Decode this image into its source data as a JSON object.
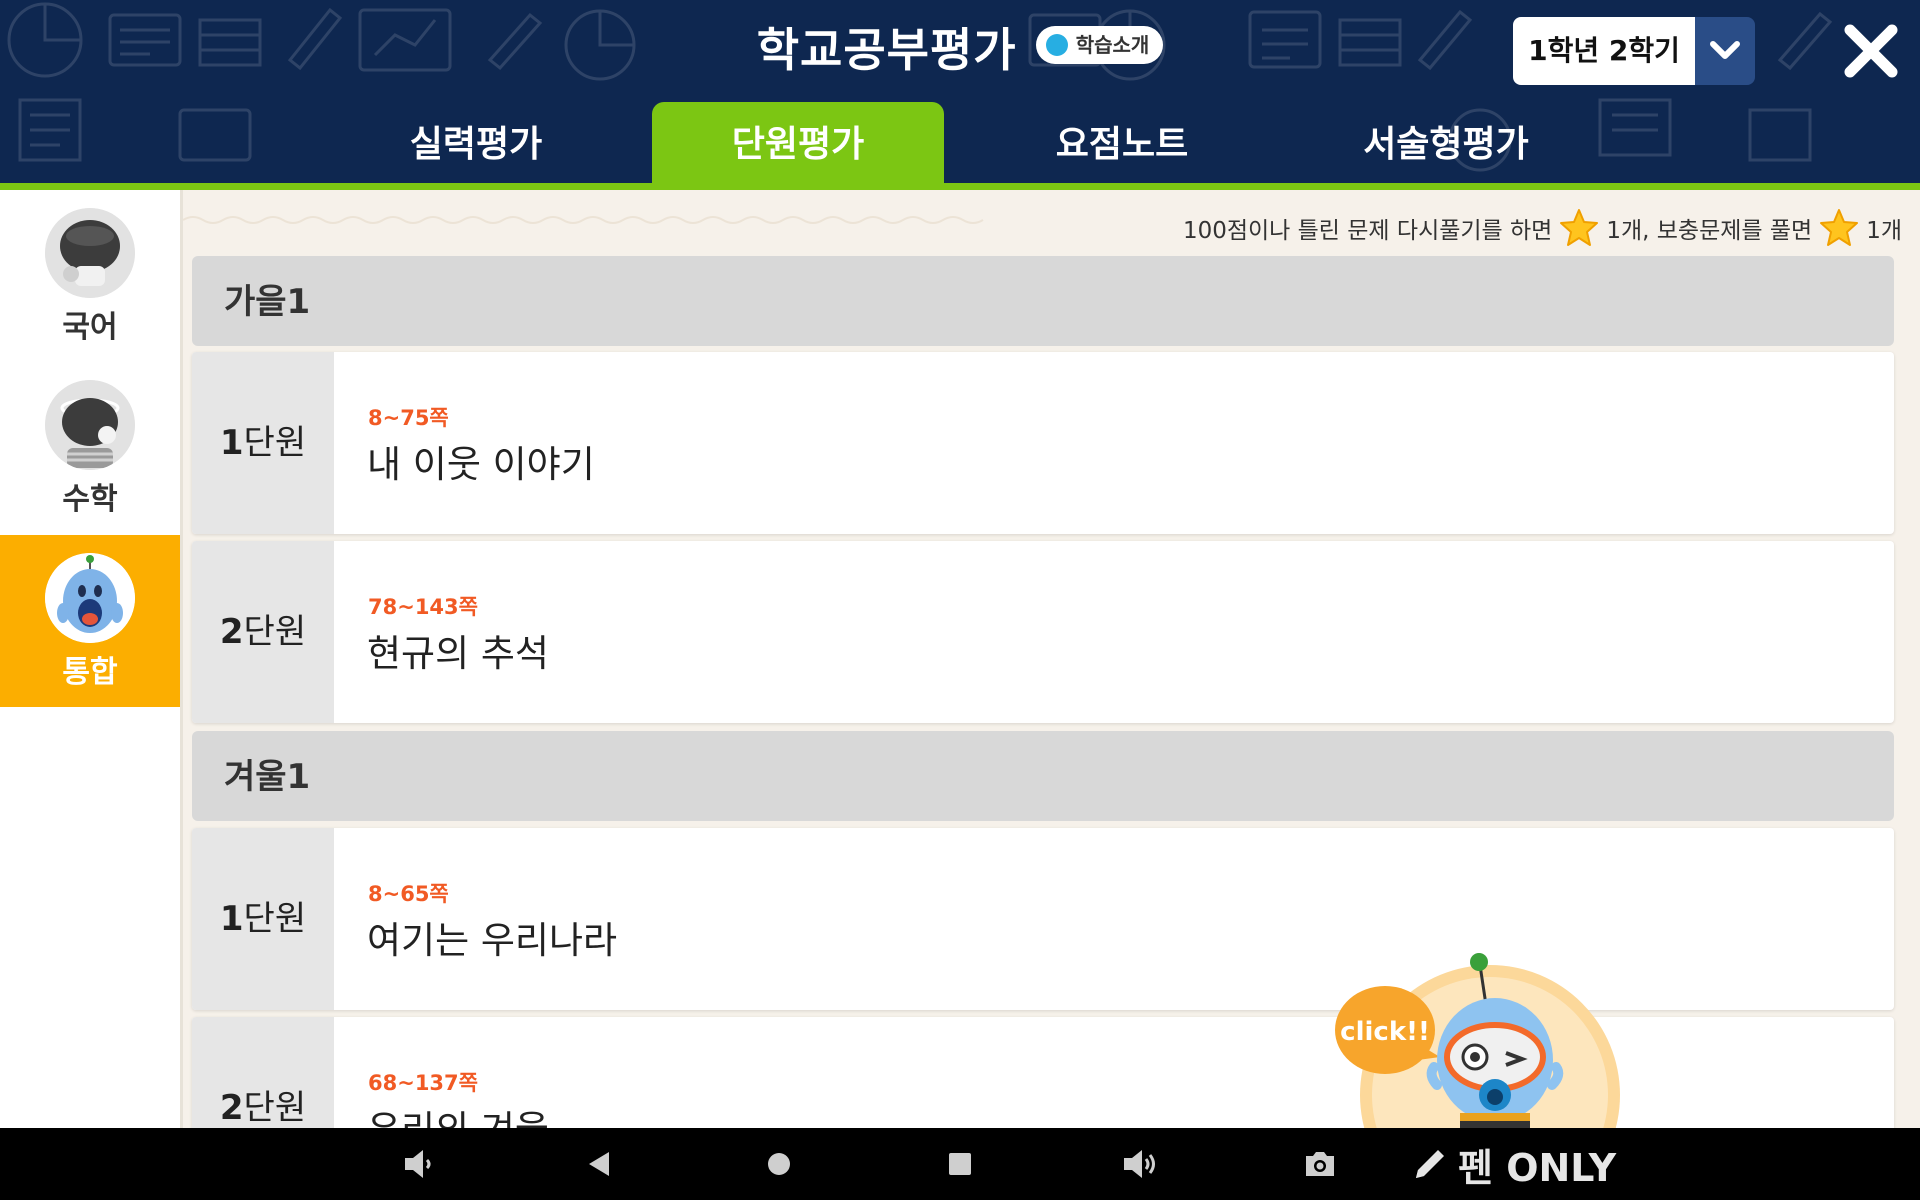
{
  "header": {
    "title": "학교공부평가",
    "intro_button": "학습소개",
    "grade_select": "1학년 2학기",
    "tabs": [
      {
        "label": "실력평가",
        "active": false
      },
      {
        "label": "단원평가",
        "active": true
      },
      {
        "label": "요점노트",
        "active": false
      },
      {
        "label": "서술형평가",
        "active": false
      }
    ]
  },
  "sidebar": {
    "items": [
      {
        "label": "국어",
        "active": false
      },
      {
        "label": "수학",
        "active": false
      },
      {
        "label": "통합",
        "active": true
      }
    ]
  },
  "notice": {
    "part1": "100점이나 틀린 문제 다시풀기를 하면",
    "part2": "1개, 보충문제를 풀면",
    "part3": "1개"
  },
  "sections": [
    {
      "title": "가을1",
      "units": [
        {
          "num": "1",
          "suffix": "단원",
          "pages": "8~75쪽",
          "title": "내 이웃 이야기"
        },
        {
          "num": "2",
          "suffix": "단원",
          "pages": "78~143쪽",
          "title": "현규의 추석"
        }
      ]
    },
    {
      "title": "겨울1",
      "units": [
        {
          "num": "1",
          "suffix": "단원",
          "pages": "8~65쪽",
          "title": "여기는 우리나라"
        },
        {
          "num": "2",
          "suffix": "단원",
          "pages": "68~137쪽",
          "title": "우리의 겨울"
        }
      ]
    }
  ],
  "mascot": {
    "bubble": "click!!"
  },
  "navbar": {
    "pen_label": "펜 ONLY",
    "icons": [
      "volume-down-icon",
      "back-icon",
      "home-icon",
      "recents-icon",
      "volume-up-icon",
      "camera-icon",
      "pen-icon"
    ]
  },
  "colors": {
    "header_bg": "#0e2750",
    "tab_active": "#7cc613",
    "sidebar_active": "#fcae00",
    "pages_text": "#f15a24",
    "grade_arrow_bg": "#2a4d87"
  }
}
